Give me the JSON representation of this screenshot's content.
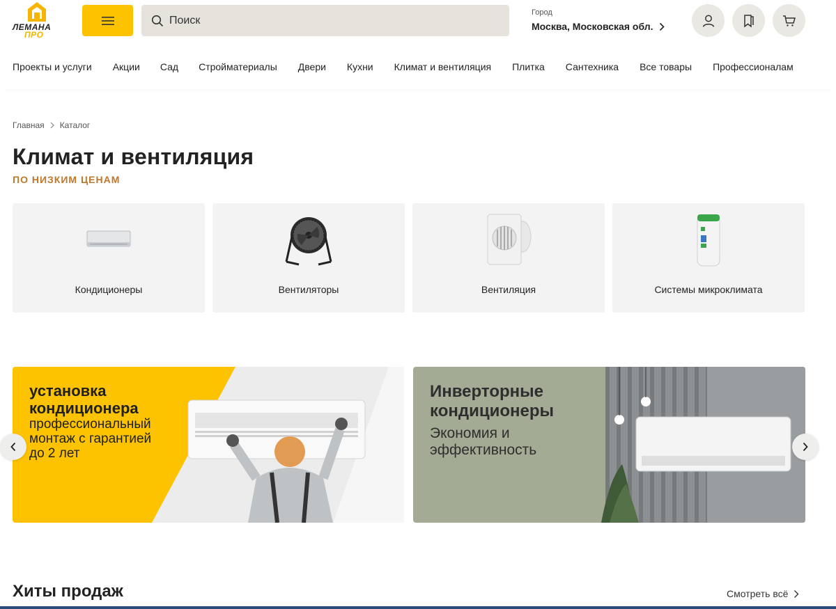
{
  "header": {
    "logo": {
      "line1": "ЛЕМАНА",
      "line2": "ПРО"
    },
    "search": {
      "placeholder": "Поиск"
    },
    "city": {
      "label": "Город",
      "value": "Москва, Московская обл."
    }
  },
  "nav": [
    "Проекты и услуги",
    "Акции",
    "Сад",
    "Стройматериалы",
    "Двери",
    "Кухни",
    "Климат и вентиляция",
    "Плитка",
    "Сантехника",
    "Все товары",
    "Профессионалам"
  ],
  "breadcrumb": [
    "Главная",
    "Каталог"
  ],
  "page": {
    "title": "Климат и вентиляция",
    "subtitle": "ПО НИЗКИМ ЦЕНАМ"
  },
  "categories": [
    {
      "name": "Кондиционеры",
      "icon": "air-conditioner-image"
    },
    {
      "name": "Вентиляторы",
      "icon": "floor-fan-image"
    },
    {
      "name": "Вентиляция",
      "icon": "exhaust-fan-image"
    },
    {
      "name": "Системы микроклимата",
      "icon": "air-purifier-image"
    }
  ],
  "banners": [
    {
      "title": "установка кондиционера",
      "text": "профессиональный монтаж с гарантией до 2 лет"
    },
    {
      "title": "Инверторные кондиционеры",
      "text": "Экономия и эффективность"
    }
  ],
  "hits": {
    "title": "Хиты продаж",
    "see_all": "Смотреть всё"
  },
  "colors": {
    "brand_yellow": "#fdc300",
    "accent_orange": "#c2762b",
    "banner_green": "#a3ab94"
  }
}
